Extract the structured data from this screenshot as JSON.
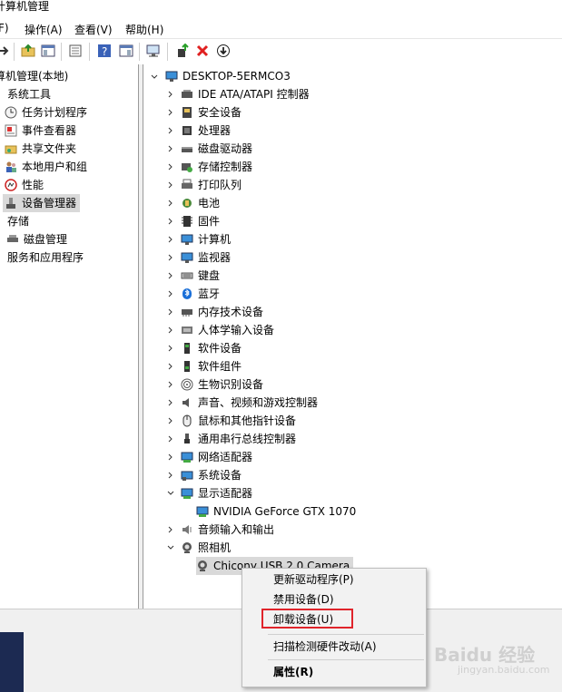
{
  "window": {
    "title": "计算机管理"
  },
  "menu": {
    "file": "F)",
    "action": "操作(A)",
    "view": "查看(V)",
    "help": "帮助(H)"
  },
  "left_tree": [
    {
      "label": "算机管理(本地)"
    },
    {
      "label": "系统工具"
    },
    {
      "label": "任务计划程序"
    },
    {
      "label": "事件查看器"
    },
    {
      "label": "共享文件夹"
    },
    {
      "label": "本地用户和组"
    },
    {
      "label": "性能"
    },
    {
      "label": "设备管理器"
    },
    {
      "label": "存储"
    },
    {
      "label": "磁盘管理"
    },
    {
      "label": "服务和应用程序"
    }
  ],
  "device_tree": {
    "root": "DESKTOP-5ERMCO3",
    "categories": [
      {
        "label": "IDE ATA/ATAPI 控制器"
      },
      {
        "label": "安全设备"
      },
      {
        "label": "处理器"
      },
      {
        "label": "磁盘驱动器"
      },
      {
        "label": "存储控制器"
      },
      {
        "label": "打印队列"
      },
      {
        "label": "电池"
      },
      {
        "label": "固件"
      },
      {
        "label": "计算机"
      },
      {
        "label": "监视器"
      },
      {
        "label": "键盘"
      },
      {
        "label": "蓝牙"
      },
      {
        "label": "内存技术设备"
      },
      {
        "label": "人体学输入设备"
      },
      {
        "label": "软件设备"
      },
      {
        "label": "软件组件"
      },
      {
        "label": "生物识别设备"
      },
      {
        "label": "声音、视频和游戏控制器"
      },
      {
        "label": "鼠标和其他指针设备"
      },
      {
        "label": "通用串行总线控制器"
      },
      {
        "label": "网络适配器"
      },
      {
        "label": "系统设备"
      },
      {
        "label": "显示适配器"
      },
      {
        "label": "NVIDIA GeForce GTX 1070"
      },
      {
        "label": "音频输入和输出"
      },
      {
        "label": "照相机"
      },
      {
        "label": "Chicony USB 2.0 Camera"
      }
    ]
  },
  "context_menu": {
    "update_driver": "更新驱动程序(P)",
    "disable": "禁用设备(D)",
    "uninstall": "卸载设备(U)",
    "scan": "扫描检测硬件改动(A)",
    "properties": "属性(R)"
  },
  "watermark": {
    "text": "Baidu 经验",
    "sub": "jingyan.baidu.com"
  },
  "colors": {
    "highlight_box": "#e0242b",
    "selected_row": "#d9d9d9"
  }
}
